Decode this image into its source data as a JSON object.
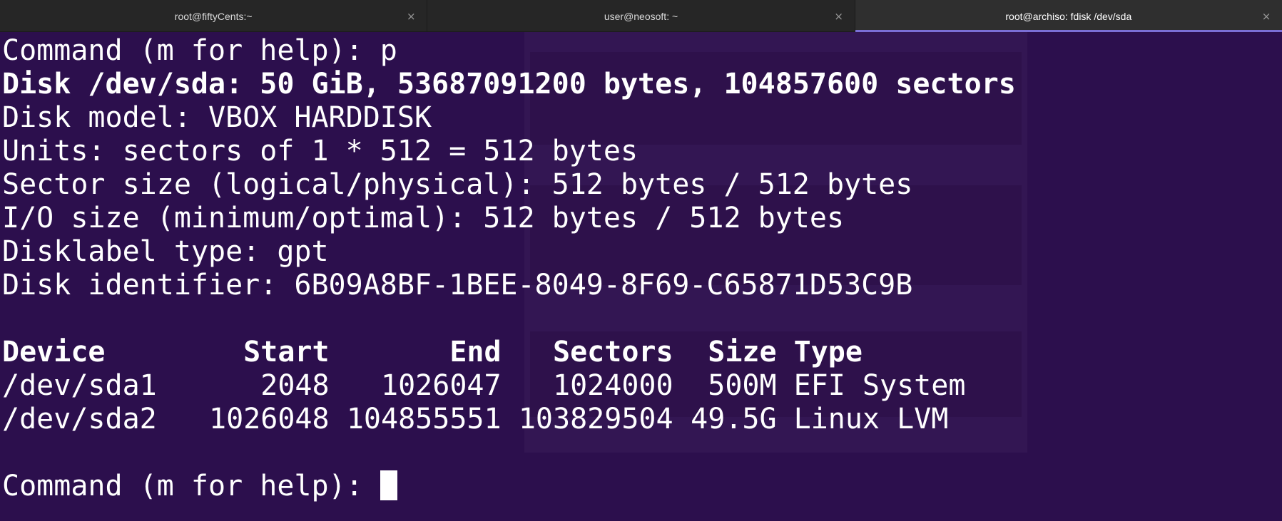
{
  "tabs": [
    {
      "title": "root@fiftyCents:~",
      "active": false
    },
    {
      "title": "user@neosoft: ~",
      "active": false
    },
    {
      "title": "root@archiso: fdisk /dev/sda",
      "active": true
    }
  ],
  "tab_close_glyph": "×",
  "terminal": {
    "prompt_line": "Command (m for help): p",
    "disk_line": "Disk /dev/sda: 50 GiB, 53687091200 bytes, 104857600 sectors",
    "info_lines": [
      "Disk model: VBOX HARDDISK",
      "Units: sectors of 1 * 512 = 512 bytes",
      "Sector size (logical/physical): 512 bytes / 512 bytes",
      "I/O size (minimum/optimal): 512 bytes / 512 bytes",
      "Disklabel type: gpt",
      "Disk identifier: 6B09A8BF-1BEE-8049-8F69-C65871D53C9B"
    ],
    "partition_table": {
      "headers": [
        "Device",
        "Start",
        "End",
        "Sectors",
        "Size",
        "Type"
      ],
      "rows": [
        [
          "/dev/sda1",
          "2048",
          "1026047",
          "1024000",
          "500M",
          "EFI System"
        ],
        [
          "/dev/sda2",
          "1026048",
          "104855551",
          "103829504",
          "49.5G",
          "Linux LVM"
        ]
      ]
    },
    "final_prompt": "Command (m for help): "
  },
  "colors": {
    "terminal_bg": "#2c0f4d",
    "terminal_fg": "#ffffff",
    "tabbar_bg": "#262626",
    "active_tab_accent": "#7b6fd6"
  }
}
